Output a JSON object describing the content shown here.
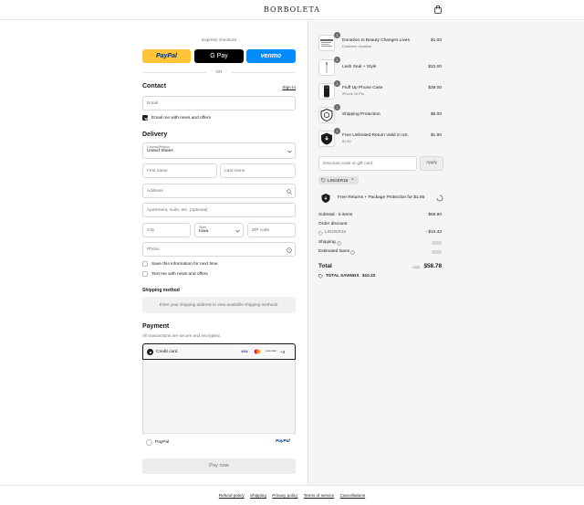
{
  "brand": "BORBOLETA",
  "express": {
    "title": "Express checkout",
    "or": "OR",
    "paypal": "PayPal",
    "gpay": "G Pay",
    "venmo": "venmo"
  },
  "contact": {
    "title": "Contact",
    "signin": "Sign in",
    "email_placeholder": "Email",
    "news_label": "Email me with news and offers",
    "news_checked": true
  },
  "delivery": {
    "title": "Delivery",
    "country_label": "Country/Region",
    "country_value": "United States",
    "first_name": "First name",
    "last_name": "Last name",
    "address": "Address",
    "apartment": "Apartment, suite, etc. (optional)",
    "city": "City",
    "state_label": "State",
    "state_value": "Iowa",
    "zip": "ZIP code",
    "phone": "Phone",
    "save_info": "Save this information for next time",
    "text_me": "Text me with news and offers"
  },
  "shipping_method": {
    "title": "Shipping method",
    "message": "Enter your shipping address to view available shipping methods."
  },
  "payment": {
    "title": "Payment",
    "subtitle": "All transactions are secure and encrypted.",
    "credit_card": "Credit card",
    "cards": [
      "VISA",
      "MC",
      "DISCOVER"
    ],
    "more": "+3",
    "paypal_label": "PayPal",
    "paypal_logo": "PayPal",
    "pay_now": "Pay now"
  },
  "cart": {
    "items": [
      {
        "name": "Donation to Beauty Changes Lives",
        "sub": "Customer donation",
        "price": "$1.00",
        "qty": "1",
        "icon": "donation-thumbnail"
      },
      {
        "name": "Lash Seal + Style",
        "sub": "",
        "price": "$22.00",
        "qty": "1",
        "icon": "lash-seal-thumbnail"
      },
      {
        "name": "Fluff Up Phone Case",
        "sub": "iPhone 16 Pro",
        "price": "$39.00",
        "qty": "1",
        "icon": "phone-case-thumbnail"
      },
      {
        "name": "Shipping Protection",
        "sub": "",
        "price": "$5.00",
        "qty": "1",
        "icon": "shield-box-icon"
      },
      {
        "name": "Free Unlimited Return Valid in US.",
        "sub": "$1.90",
        "price": "$1.90",
        "qty": "1",
        "icon": "return-shield-icon"
      }
    ],
    "discount_placeholder": "Discount code or gift card",
    "apply": "Apply",
    "code_tag": "LINGER15",
    "upsell": "Free Returns + Package Protection for $1.65",
    "subtotal_label": "Subtotal · 5 items",
    "subtotal_value": "$68.90",
    "order_discount_label": "Order discount",
    "discount_code": "LINGER15",
    "discount_value": "- $10.33",
    "shipping_label": "Shipping",
    "taxes_label": "Estimated taxes",
    "total_label": "Total",
    "currency": "USD",
    "total_value": "$58.78",
    "savings_label": "TOTAL SAVINGS",
    "savings_value": "$10.33"
  },
  "footer": [
    "Refund policy",
    "Shipping",
    "Privacy policy",
    "Terms of service",
    "Cancellations"
  ]
}
